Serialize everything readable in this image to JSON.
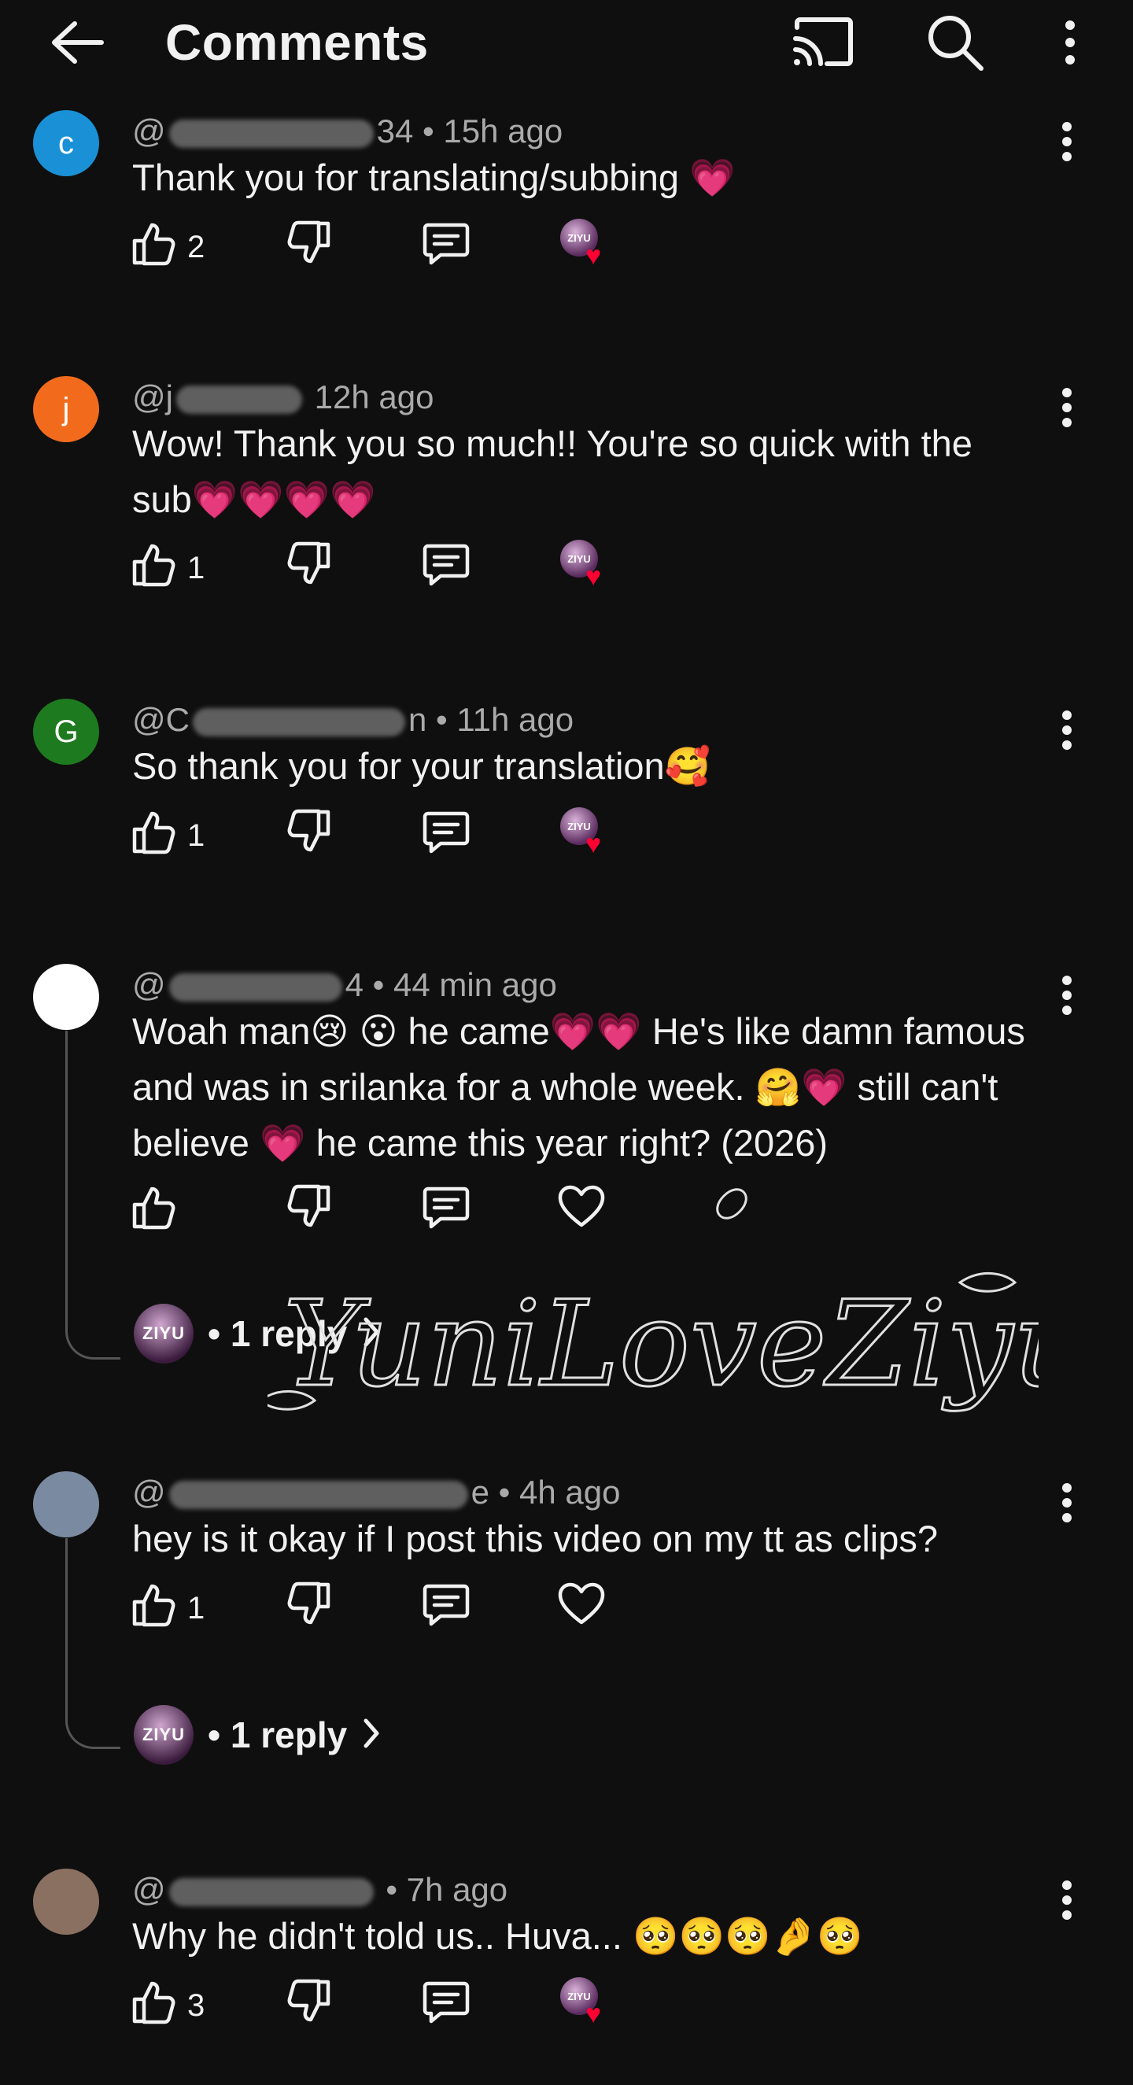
{
  "header": {
    "title": "Comments",
    "icons": [
      "back-arrow-icon",
      "cast-icon",
      "search-icon",
      "more-vert-icon"
    ]
  },
  "comments": [
    {
      "avatar_letter": "c",
      "avatar_color": "#1a91d6",
      "handle_prefix": "@",
      "handle_suffix": "34",
      "time": "• 15h ago",
      "text": "Thank you for translating/subbing 💗",
      "likes": "2",
      "creator_heart": true
    },
    {
      "avatar_letter": "j",
      "avatar_color": "#f26b1d",
      "handle_prefix": "@j",
      "handle_suffix": "",
      "time": "12h ago",
      "text": "Wow! Thank you so much!! You're so quick with the sub💗💗💗💗",
      "likes": "1",
      "creator_heart": true
    },
    {
      "avatar_letter": "G",
      "avatar_color": "#1e7a1e",
      "handle_prefix": "@C",
      "handle_suffix": "n",
      "time": "• 11h ago",
      "text": "So thank you for your translation🥰",
      "likes": "1",
      "creator_heart": true
    },
    {
      "avatar_letter": "",
      "avatar_color": "#ffffff",
      "handle_prefix": "@",
      "handle_suffix": "4",
      "time": "• 44 min ago",
      "text": "Woah man😢 😮 he came💗💗  He's like damn famous and was in srilanka for a whole week. 🤗💗 still can't believe 💗 he came this year right? (2026)",
      "likes": "",
      "creator_heart": false,
      "reply_count": "• 1 reply",
      "reply_avatar_text": "ZIYU"
    },
    {
      "avatar_letter": "",
      "avatar_color": "#7a8aa0",
      "handle_prefix": "@",
      "handle_suffix": "e",
      "time": "• 4h ago",
      "text": "hey is it okay if I post this video on my tt as clips?",
      "likes": "1",
      "creator_heart": false,
      "reply_count": "• 1 reply",
      "reply_avatar_text": "ZIYU"
    },
    {
      "avatar_letter": "",
      "avatar_color": "#8a7060",
      "handle_prefix": "@",
      "handle_suffix": "",
      "time": "• 7h ago",
      "text": "Why he didn't told us.. Huva... 🥺🥺🥺🤌🥺",
      "likes": "3",
      "creator_heart": true
    }
  ],
  "creator_badge_text": "ZIYU",
  "watermark": "YuniLoveZiyu",
  "colors": {
    "background": "#0f0f0f",
    "text": "#f1f1f1",
    "meta": "#aaaaaa",
    "heart": "#ff0033"
  }
}
